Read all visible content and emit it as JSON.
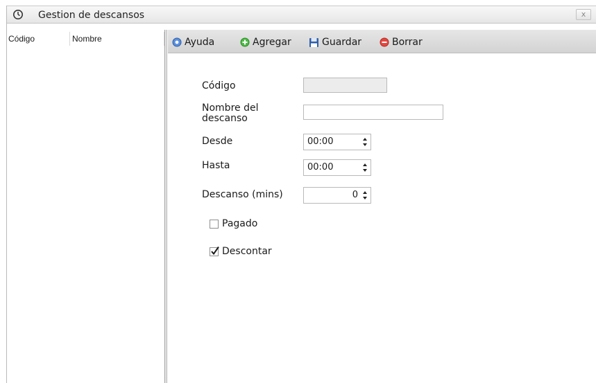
{
  "window": {
    "title": "Gestion de descansos",
    "close_label": "x"
  },
  "list": {
    "columns": [
      "Código",
      "Nombre"
    ]
  },
  "toolbar": {
    "help_label": "Ayuda",
    "add_label": "Agregar",
    "save_label": "Guardar",
    "delete_label": "Borrar"
  },
  "form": {
    "codigo_label": "Código",
    "codigo_value": "",
    "nombre_label_1": "Nombre del",
    "nombre_label_2": "descanso",
    "nombre_value": "",
    "desde_label": "Desde",
    "desde_value": "00:00",
    "hasta_label": "Hasta",
    "hasta_value": "00:00",
    "descanso_label": "Descanso (mins)",
    "descanso_value": "0",
    "pagado_label": "Pagado",
    "pagado_checked": false,
    "descontar_label": "Descontar",
    "descontar_checked": true
  },
  "colors": {
    "help": "#4a7fd0",
    "add": "#3fae3a",
    "save": "#2e5ea8",
    "delete": "#e0413a"
  }
}
